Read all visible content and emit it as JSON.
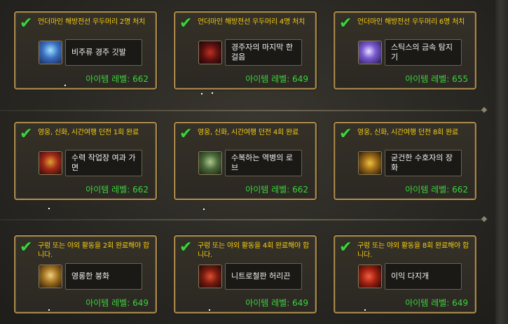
{
  "ilvl_label": "아이템 레벨:",
  "colors": {
    "frame": "#a7884a",
    "task_text": "#f5cc10",
    "check": "#3cd43c",
    "ilvl": "#3cd43c"
  },
  "cards": [
    {
      "task": "언더마인 해방전선 우두머리 2명 처치",
      "item": "비주류 경주 깃발",
      "ilvl": "662",
      "icon": "blue-banner-icon"
    },
    {
      "task": "언더마인 해방전선 우두머리 4명 처치",
      "item": "경주자의 마지막 한 걸음",
      "ilvl": "649",
      "icon": "red-boot-icon"
    },
    {
      "task": "언더마인 해방전선 우두머리 6명 처치",
      "item": "스틱스의 금속 탐지기",
      "ilvl": "655",
      "icon": "purple-wand-icon"
    },
    {
      "task": "영웅, 신화, 시간여행 던전 1회 완료",
      "item": "수력 작업장 여과 가면",
      "ilvl": "662",
      "icon": "gold-helm-icon"
    },
    {
      "task": "영웅, 신화, 시간여행 던전 4회 완료",
      "item": "수복하는 역병의 로브",
      "ilvl": "662",
      "icon": "green-robe-icon"
    },
    {
      "task": "영웅, 신화, 시간여행 던전 8회 완료",
      "item": "굳건한 수호자의 장화",
      "ilvl": "662",
      "icon": "gold-boot-icon"
    },
    {
      "task": "구렁 또는 야외 활동을 2회 완료해야 합니다.",
      "item": "영롱한 붕화",
      "ilvl": "649",
      "icon": "gold-trinket-icon"
    },
    {
      "task": "구렁 또는 야외 활동을 4회 완료해야 합니다.",
      "item": "니트로철판 허리끈",
      "ilvl": "649",
      "icon": "red-belt-icon"
    },
    {
      "task": "구렁 또는 야외 활동을 8회 완료해야 합니다.",
      "item": "이익 다지개",
      "ilvl": "649",
      "icon": "red-hammer-icon"
    }
  ]
}
